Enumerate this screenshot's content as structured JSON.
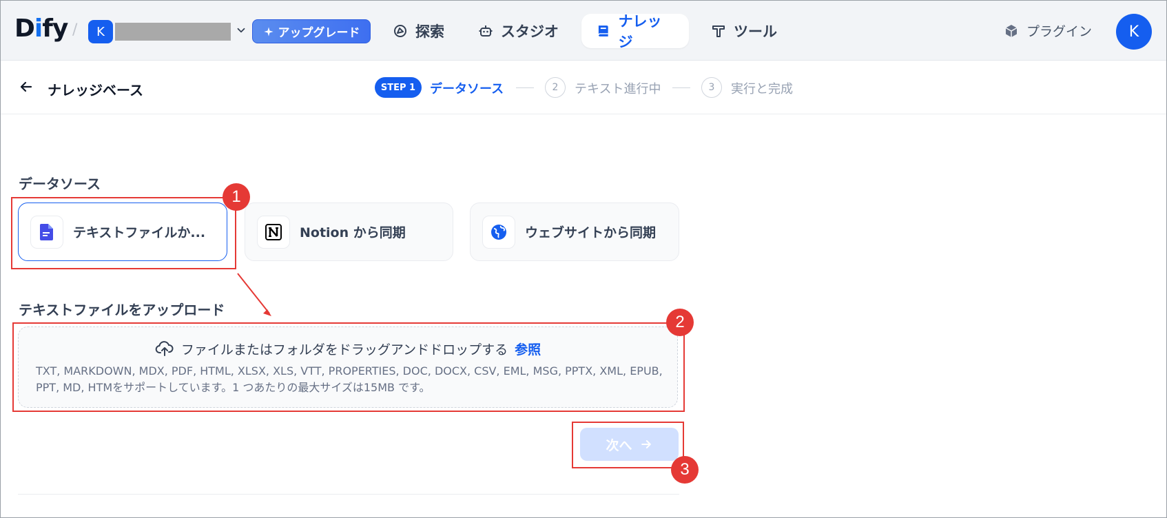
{
  "app": {
    "logo_prefix": "D",
    "logo_blue": "i",
    "logo_suffix": "fy"
  },
  "workspace": {
    "avatar_letter": "K"
  },
  "upgrade_label": "アップグレード",
  "nav": {
    "items": [
      {
        "label": "探索",
        "icon": "compass-icon"
      },
      {
        "label": "スタジオ",
        "icon": "robot-icon"
      },
      {
        "label": "ナレッジ",
        "icon": "book-icon",
        "active": true
      },
      {
        "label": "ツール",
        "icon": "hammer-icon"
      }
    ],
    "plugin_label": "プラグイン",
    "user_avatar_letter": "K"
  },
  "header": {
    "title": "ナレッジベース",
    "steps": [
      {
        "badge": "STEP 1",
        "label": "データソース",
        "active": true
      },
      {
        "num": "2",
        "label": "テキスト進行中"
      },
      {
        "num": "3",
        "label": "実行と完成"
      }
    ]
  },
  "data_source": {
    "title": "データソース",
    "options": [
      {
        "label": "テキストファイルか...",
        "icon": "file-text-icon",
        "selected": true
      },
      {
        "label": "Notion から同期",
        "icon": "notion-icon"
      },
      {
        "label": "ウェブサイトから同期",
        "icon": "globe-icon"
      }
    ]
  },
  "upload": {
    "title": "テキストファイルをアップロード",
    "main_text": "ファイルまたはフォルダをドラッグアンドドロップする",
    "browse_label": "参照",
    "note": "TXT, MARKDOWN, MDX, PDF, HTML, XLSX, XLS, VTT, PROPERTIES, DOC, DOCX, CSV, EML, MSG, PPTX, XML, EPUB, PPT, MD, HTMをサポートしています。1 つあたりの最大サイズは15MB です。"
  },
  "next_button": {
    "label": "次へ"
  },
  "annotations": [
    "1",
    "2",
    "3"
  ],
  "colors": {
    "accent": "#155eef",
    "annotation": "#e53935"
  }
}
